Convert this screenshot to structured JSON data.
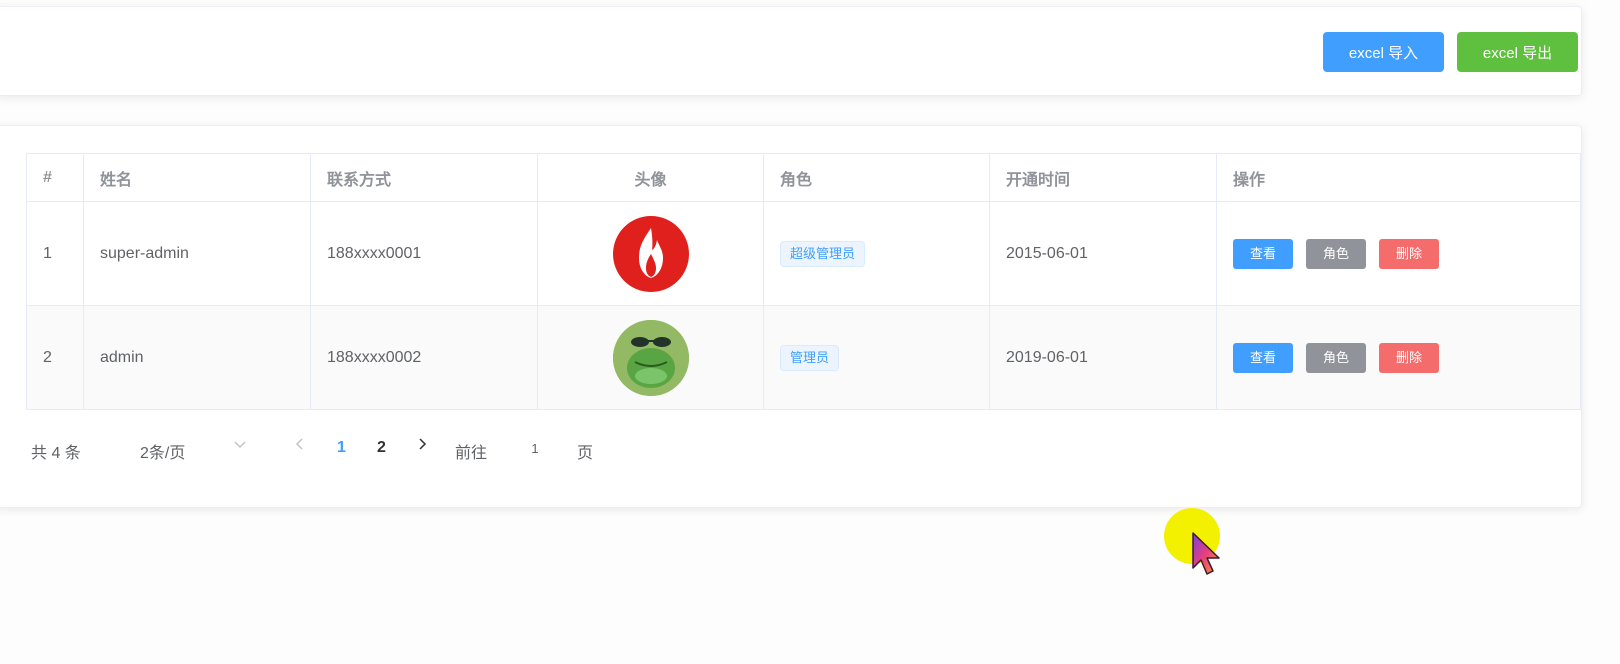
{
  "toolbar": {
    "import_label": "excel 导入",
    "export_label": "excel 导出"
  },
  "table": {
    "columns": [
      "#",
      "姓名",
      "联系方式",
      "头像",
      "角色",
      "开通时间",
      "操作"
    ],
    "rows": [
      {
        "index": "1",
        "name": "super-admin",
        "contact": "188xxxx0001",
        "avatar": "fire-logo-avatar",
        "role": "超级管理员",
        "opened": "2015-06-01"
      },
      {
        "index": "2",
        "name": "admin",
        "contact": "188xxxx0002",
        "avatar": "frog-sunglasses-avatar",
        "role": "管理员",
        "opened": "2019-06-01"
      }
    ],
    "actions": {
      "view": "查看",
      "role": "角色",
      "delete": "删除"
    }
  },
  "pagination": {
    "total": "共 4 条",
    "page_size": "2条/页",
    "pages": [
      "1",
      "2"
    ],
    "current_page": "1",
    "goto_label": "前往",
    "goto_value": "1",
    "page_unit": "页"
  },
  "colors": {
    "primary": "#409eff",
    "success": "#5fbf3e",
    "info": "#909399",
    "danger": "#f56c6c",
    "cursor_highlight": "#f3f000"
  }
}
